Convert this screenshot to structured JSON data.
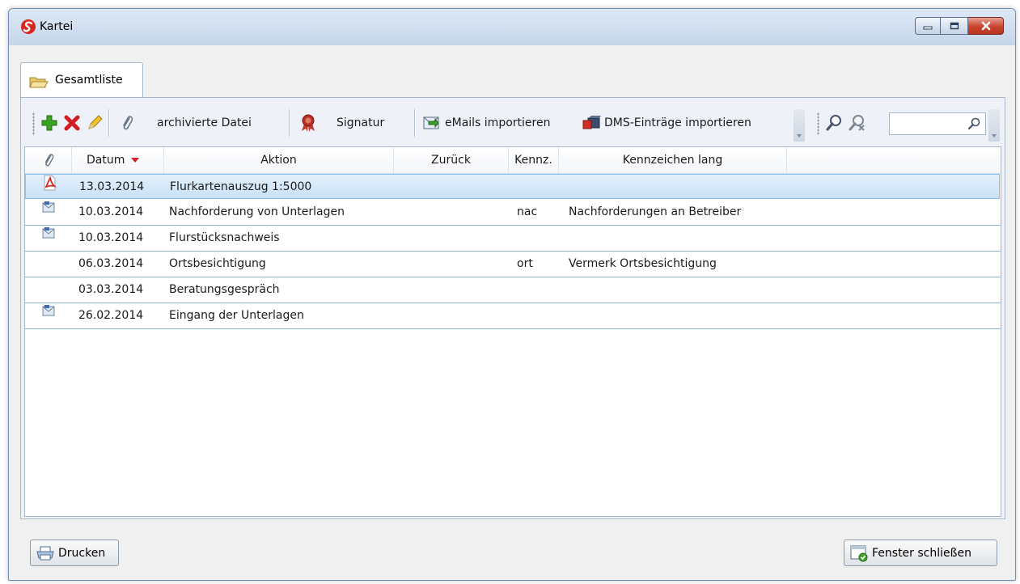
{
  "window": {
    "title": "Kartei",
    "icons": {
      "logo": "app-logo-icon",
      "minimize": "minimize-icon",
      "maximize": "maximize-icon",
      "close": "close-icon"
    }
  },
  "tabs": [
    {
      "label": "Gesamtliste",
      "icon": "folder-icon"
    }
  ],
  "toolbar": {
    "add": "add-icon",
    "delete": "delete-icon",
    "edit": "pencil-icon",
    "archived_file": {
      "icon": "paperclip-icon",
      "label": "archivierte Datei"
    },
    "signature": {
      "icon": "seal-icon",
      "label": "Signatur"
    },
    "import_emails": {
      "icon": "email-import-icon",
      "label": "eMails importieren"
    },
    "import_dms": {
      "icon": "dms-import-icon",
      "label": "DMS-Einträge importieren"
    },
    "search_icons": [
      "magnifier-icon",
      "find-user-icon"
    ],
    "search_input": {
      "value": "",
      "icon": "search-icon"
    }
  },
  "grid": {
    "columns": [
      {
        "key": "attach",
        "label": "",
        "icon": "paperclip-icon"
      },
      {
        "key": "datum",
        "label": "Datum",
        "sorted": "desc"
      },
      {
        "key": "aktion",
        "label": "Aktion"
      },
      {
        "key": "zurueck",
        "label": "Zurück"
      },
      {
        "key": "kennz",
        "label": "Kennz."
      },
      {
        "key": "kennz_lang",
        "label": "Kennzeichen lang"
      }
    ],
    "rows": [
      {
        "icon": "pdf-icon",
        "datum": "13.03.2014",
        "aktion": "Flurkartenauszug 1:5000",
        "zurueck": "",
        "kennz": "",
        "kennz_lang": "",
        "selected": true
      },
      {
        "icon": "email-icon",
        "datum": "10.03.2014",
        "aktion": "Nachforderung von Unterlagen",
        "zurueck": "",
        "kennz": "nac",
        "kennz_lang": "Nachforderungen an Betreiber"
      },
      {
        "icon": "email-icon",
        "datum": "10.03.2014",
        "aktion": "Flurstücksnachweis",
        "zurueck": "",
        "kennz": "",
        "kennz_lang": ""
      },
      {
        "icon": "",
        "datum": "06.03.2014",
        "aktion": "Ortsbesichtigung",
        "zurueck": "",
        "kennz": "ort",
        "kennz_lang": "Vermerk Ortsbesichtigung"
      },
      {
        "icon": "",
        "datum": "03.03.2014",
        "aktion": "Beratungsgespräch",
        "zurueck": "",
        "kennz": "",
        "kennz_lang": ""
      },
      {
        "icon": "email-icon",
        "datum": "26.02.2014",
        "aktion": "Eingang der Unterlagen",
        "zurueck": "",
        "kennz": "",
        "kennz_lang": ""
      }
    ]
  },
  "footer": {
    "print": {
      "icon": "printer-icon",
      "label": "Drucken"
    },
    "close": {
      "icon": "close-window-icon",
      "label": "Fenster schließen"
    }
  }
}
